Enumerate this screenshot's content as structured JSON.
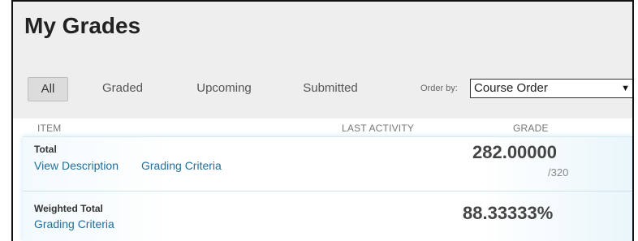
{
  "page": {
    "title": "My Grades"
  },
  "filters": {
    "tabs": [
      {
        "label": "All",
        "active": true
      },
      {
        "label": "Graded",
        "active": false
      },
      {
        "label": "Upcoming",
        "active": false
      },
      {
        "label": "Submitted",
        "active": false
      }
    ],
    "order_label": "Order by:",
    "order_value": "Course Order"
  },
  "table": {
    "headers": {
      "item": "ITEM",
      "last_activity": "LAST ACTIVITY",
      "grade": "GRADE"
    },
    "rows": [
      {
        "title": "Total",
        "links": [
          "View Description",
          "Grading Criteria"
        ],
        "grade": "282.00000",
        "out_of": "/320"
      },
      {
        "title": "Weighted Total",
        "links": [
          "Grading Criteria"
        ],
        "grade": "88.33333%",
        "out_of": ""
      }
    ]
  },
  "colors": {
    "link": "#1f6f9a",
    "header_bg": "#eeeeee",
    "accent_row": "#eaf6fb"
  }
}
